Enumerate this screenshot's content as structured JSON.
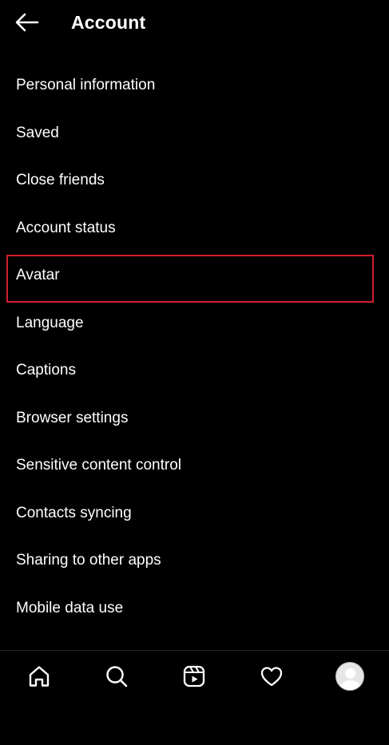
{
  "header": {
    "title": "Account",
    "back_icon": "arrow-left-icon"
  },
  "menu": {
    "items": [
      {
        "label": "Personal information"
      },
      {
        "label": "Saved"
      },
      {
        "label": "Close friends"
      },
      {
        "label": "Account status"
      },
      {
        "label": "Avatar",
        "highlighted": true
      },
      {
        "label": "Language"
      },
      {
        "label": "Captions"
      },
      {
        "label": "Browser settings"
      },
      {
        "label": "Sensitive content control"
      },
      {
        "label": "Contacts syncing"
      },
      {
        "label": "Sharing to other apps"
      },
      {
        "label": "Mobile data use"
      }
    ]
  },
  "highlight_color": "#d0202f",
  "bottom_nav": {
    "items": [
      {
        "icon": "home-icon"
      },
      {
        "icon": "search-icon"
      },
      {
        "icon": "reels-icon"
      },
      {
        "icon": "heart-icon"
      },
      {
        "icon": "profile-avatar"
      }
    ]
  }
}
